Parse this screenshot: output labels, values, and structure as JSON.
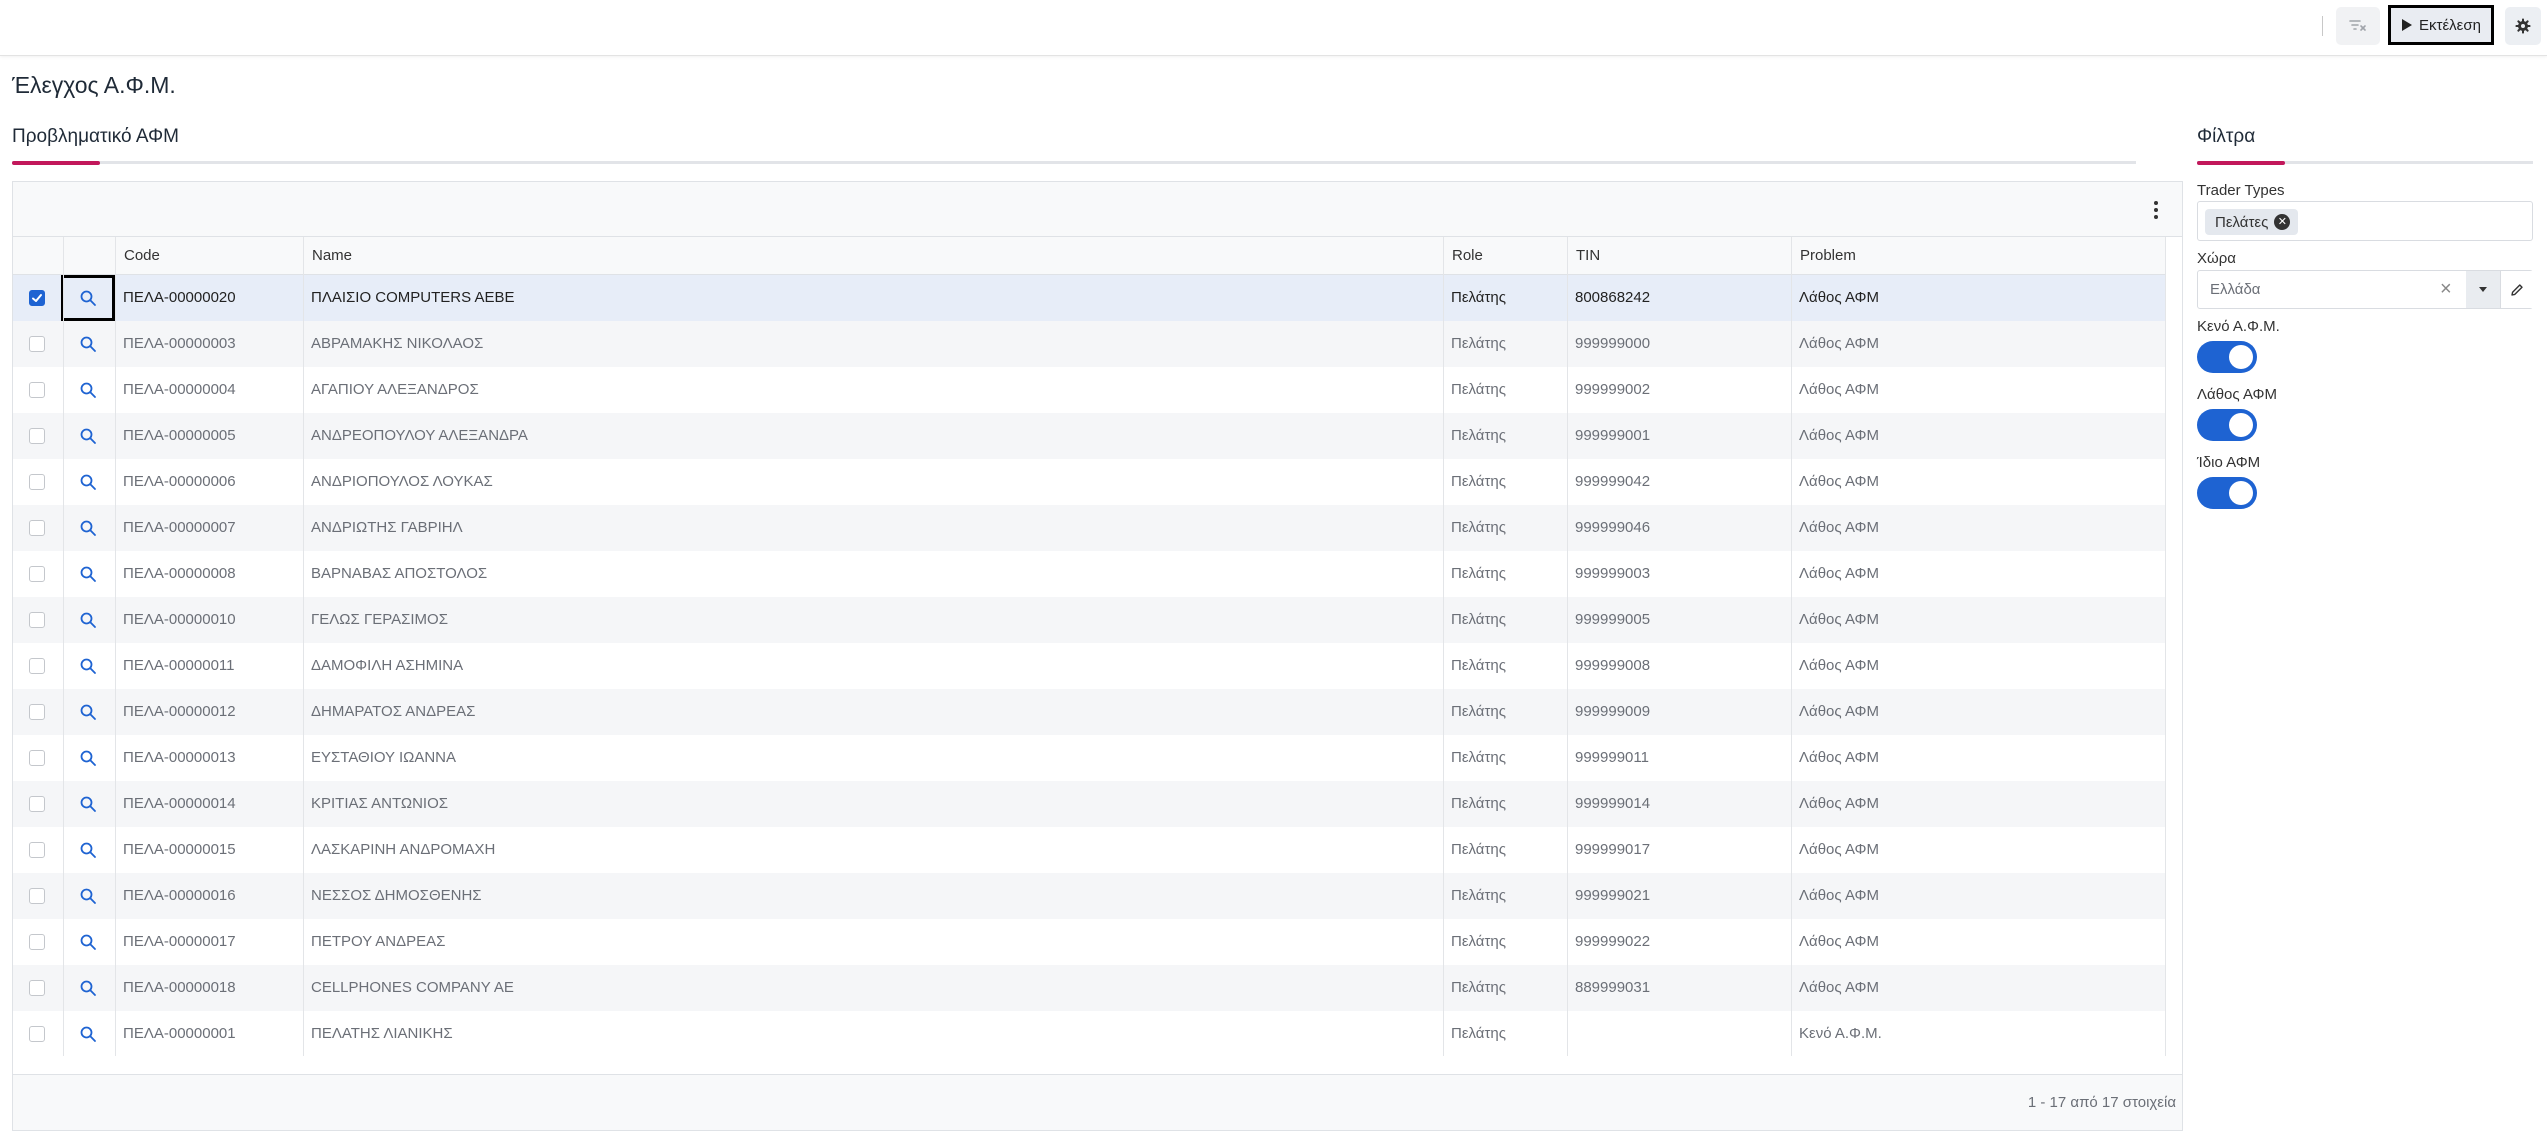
{
  "toolbar": {
    "run_label": "Εκτέλεση",
    "icons": [
      "filter-clear-icon",
      "play-icon",
      "gear-icon"
    ]
  },
  "page": {
    "title": "Έλεγχος Α.Φ.Μ."
  },
  "results": {
    "title": "Προβληματικό ΑΦΜ",
    "columns": [
      "Code",
      "Name",
      "Role",
      "TIN",
      "Problem"
    ],
    "rows": [
      {
        "code": "ΠΕΛΑ-00000020",
        "name": "ΠΛΑΙΣΙΟ COMPUTERS AEBE",
        "role": "Πελάτης",
        "tin": "800868242",
        "problem": "Λάθος ΑΦΜ",
        "checked": true
      },
      {
        "code": "ΠΕΛΑ-00000003",
        "name": "ΑΒΡΑΜΑΚΗΣ ΝΙΚΟΛΑΟΣ",
        "role": "Πελάτης",
        "tin": "999999000",
        "problem": "Λάθος ΑΦΜ",
        "checked": false
      },
      {
        "code": "ΠΕΛΑ-00000004",
        "name": "ΑΓΑΠΙΟΥ ΑΛΕΞΑΝΔΡΟΣ",
        "role": "Πελάτης",
        "tin": "999999002",
        "problem": "Λάθος ΑΦΜ",
        "checked": false
      },
      {
        "code": "ΠΕΛΑ-00000005",
        "name": "ΑΝΔΡΕΟΠΟΥΛΟΥ ΑΛΕΞΑΝΔΡΑ",
        "role": "Πελάτης",
        "tin": "999999001",
        "problem": "Λάθος ΑΦΜ",
        "checked": false
      },
      {
        "code": "ΠΕΛΑ-00000006",
        "name": "ΑΝΔΡΙΟΠΟΥΛΟΣ ΛΟΥΚΑΣ",
        "role": "Πελάτης",
        "tin": "999999042",
        "problem": "Λάθος ΑΦΜ",
        "checked": false
      },
      {
        "code": "ΠΕΛΑ-00000007",
        "name": "ΑΝΔΡΙΩΤΗΣ ΓΑΒΡΙΗΛ",
        "role": "Πελάτης",
        "tin": "999999046",
        "problem": "Λάθος ΑΦΜ",
        "checked": false
      },
      {
        "code": "ΠΕΛΑ-00000008",
        "name": "ΒΑΡΝΑΒΑΣ ΑΠΟΣΤΟΛΟΣ",
        "role": "Πελάτης",
        "tin": "999999003",
        "problem": "Λάθος ΑΦΜ",
        "checked": false
      },
      {
        "code": "ΠΕΛΑ-00000010",
        "name": "ΓΕΛΩΣ ΓΕΡΑΣΙΜΟΣ",
        "role": "Πελάτης",
        "tin": "999999005",
        "problem": "Λάθος ΑΦΜ",
        "checked": false
      },
      {
        "code": "ΠΕΛΑ-00000011",
        "name": "ΔΑΜΟΦΙΛΗ ΑΣΗΜΙΝΑ",
        "role": "Πελάτης",
        "tin": "999999008",
        "problem": "Λάθος ΑΦΜ",
        "checked": false
      },
      {
        "code": "ΠΕΛΑ-00000012",
        "name": "ΔΗΜΑΡΑΤΟΣ ΑΝΔΡΕΑΣ",
        "role": "Πελάτης",
        "tin": "999999009",
        "problem": "Λάθος ΑΦΜ",
        "checked": false
      },
      {
        "code": "ΠΕΛΑ-00000013",
        "name": "ΕΥΣΤΑΘΙΟΥ ΙΩΑΝΝΑ",
        "role": "Πελάτης",
        "tin": "999999011",
        "problem": "Λάθος ΑΦΜ",
        "checked": false
      },
      {
        "code": "ΠΕΛΑ-00000014",
        "name": "ΚΡΙΤΙΑΣ ΑΝΤΩΝΙΟΣ",
        "role": "Πελάτης",
        "tin": "999999014",
        "problem": "Λάθος ΑΦΜ",
        "checked": false
      },
      {
        "code": "ΠΕΛΑ-00000015",
        "name": "ΛΑΣΚΑΡΙΝΗ ΑΝΔΡΟΜΑΧΗ",
        "role": "Πελάτης",
        "tin": "999999017",
        "problem": "Λάθος ΑΦΜ",
        "checked": false
      },
      {
        "code": "ΠΕΛΑ-00000016",
        "name": "ΝΕΣΣΟΣ ΔΗΜΟΣΘΕΝΗΣ",
        "role": "Πελάτης",
        "tin": "999999021",
        "problem": "Λάθος ΑΦΜ",
        "checked": false
      },
      {
        "code": "ΠΕΛΑ-00000017",
        "name": "ΠΕΤΡΟΥ ΑΝΔΡΕΑΣ",
        "role": "Πελάτης",
        "tin": "999999022",
        "problem": "Λάθος ΑΦΜ",
        "checked": false
      },
      {
        "code": "ΠΕΛΑ-00000018",
        "name": "CELLPHONES COMPANY AE",
        "role": "Πελάτης",
        "tin": "889999031",
        "problem": "Λάθος ΑΦΜ",
        "checked": false
      },
      {
        "code": "ΠΕΛΑ-00000001",
        "name": "ΠΕΛΑΤΗΣ ΛΙΑΝΙΚΗΣ",
        "role": "Πελάτης",
        "tin": "",
        "problem": "Κενό Α.Φ.Μ.",
        "checked": false
      }
    ],
    "pager": "1 - 17 από 17 στοιχεία"
  },
  "filters": {
    "title": "Φίλτρα",
    "trader_types_label": "Trader Types",
    "trader_types_chip": "Πελάτες",
    "country_label": "Χώρα",
    "country_value": "Ελλάδα",
    "toggles": [
      {
        "label": "Κενό Α.Φ.Μ.",
        "on": true
      },
      {
        "label": "Λάθος ΑΦΜ",
        "on": true
      },
      {
        "label": "Ίδιο ΑΦΜ",
        "on": true
      }
    ],
    "accent_color": "#c2185b",
    "primary_color": "#1e63d2"
  }
}
